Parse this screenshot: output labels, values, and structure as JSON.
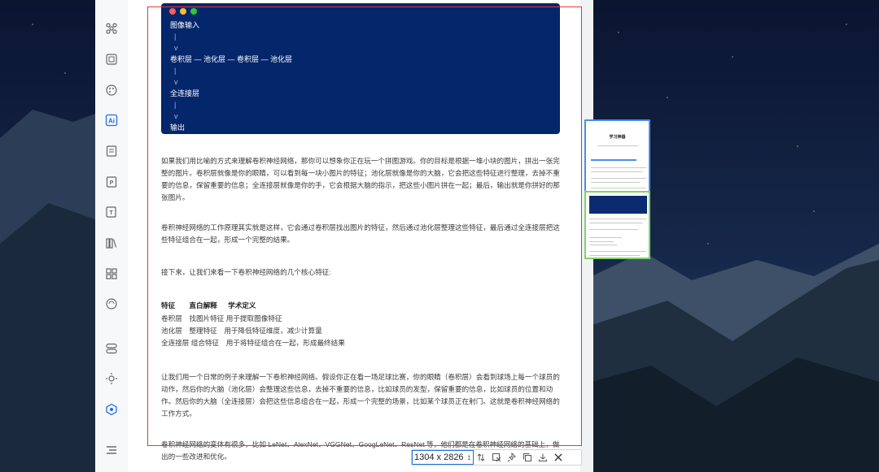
{
  "code_block": {
    "lines": [
      "图像输入",
      "  |",
      "  v",
      "卷积层 — 池化层 — 卷积层 — 池化层",
      "  |",
      "  v",
      "全连接层",
      "  |",
      "  v",
      "输出"
    ]
  },
  "article": {
    "p1": "如果我们用比喻的方式来理解卷积神经网络，那你可以想象你正在玩一个拼图游戏。你的目标是根据一堆小块的图片，拼出一张完整的图片。卷积层就像是你的眼睛，可以看到每一块小图片的特征；池化层就像是你的大脑，它会把这些特征进行整理，去掉不重要的信息，保留重要的信息；全连接层就像是你的手，它会根据大脑的指示，把这些小图片拼在一起；最后，输出就是你拼好的那张图片。",
    "p2": "卷积神经网络的工作原理其实就是这样，它会通过卷积层找出图片的特征，然后通过池化层整理这些特征，最后通过全连接层把这些特征组合在一起，形成一个完整的结果。",
    "p3": "接下来，让我们来看一下卷积神经网络的几个核心特征:",
    "table_header": "特征　　直白解释　  学术定义",
    "table_rows": [
      "卷积层　找图片特征 用于提取图像特征",
      "池化层　整理特征　用于降低特征维度，减少计算量",
      "全连接层 组合特征　用于将特征组合在一起，形成最终结果"
    ],
    "p4": "让我们用一个日常的例子来理解一下卷积神经网络。假设你正在看一场足球比赛，你的眼睛（卷积层）会看到球场上每一个球员的动作，然后你的大脑（池化层）会整理这些信息，去掉不重要的信息，比如球员的发型，保留重要的信息，比如球员的位置和动作。然后你的大脑（全连接层）会把这些信息组合在一起，形成一个完整的场景，比如某个球员正在射门。这就是卷积神经网络的工作方式。",
    "p5": "卷积神经网络的变体有很多，比如 LeNet、AlexNet、VGGNet、GoogLeNet、ResNet 等，他们都是在卷积神经网络的基础上，做出的一些改进和优化。"
  },
  "minimap": {
    "title": "学习神器"
  },
  "capture_toolbar": {
    "dimensions": "1304 x 2826"
  },
  "colors": {
    "selection": "#e53935",
    "code_bg": "#04266b",
    "accent": "#1e6fe0"
  }
}
